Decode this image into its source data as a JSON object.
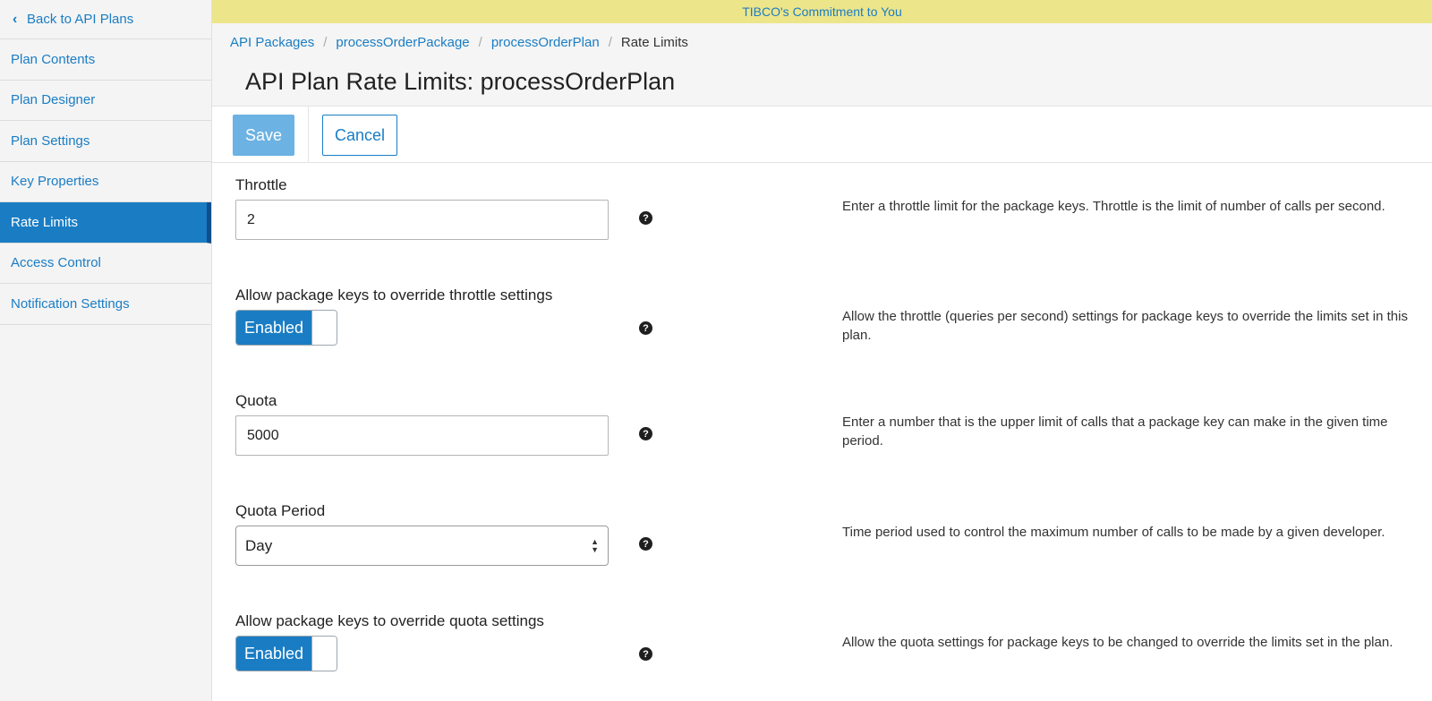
{
  "sidebar": {
    "back_label": "Back to API Plans",
    "items": [
      {
        "label": "Plan Contents"
      },
      {
        "label": "Plan Designer"
      },
      {
        "label": "Plan Settings"
      },
      {
        "label": "Key Properties"
      },
      {
        "label": "Rate Limits",
        "active": true
      },
      {
        "label": "Access Control"
      },
      {
        "label": "Notification Settings"
      }
    ]
  },
  "banner": {
    "text": "TIBCO's Commitment to You"
  },
  "breadcrumb": {
    "items": [
      "API Packages",
      "processOrderPackage",
      "processOrderPlan"
    ],
    "current": "Rate Limits",
    "separator": "/"
  },
  "page": {
    "title": "API Plan Rate Limits: processOrderPlan"
  },
  "toolbar": {
    "save_label": "Save",
    "cancel_label": "Cancel"
  },
  "form": {
    "throttle": {
      "label": "Throttle",
      "value": "2",
      "help": "Enter a throttle limit for the package keys. Throttle is the limit of number of calls per second."
    },
    "override_throttle": {
      "label": "Allow package keys to override throttle settings",
      "toggle_label": "Enabled",
      "help": "Allow the throttle (queries per second) settings for package keys to override the limits set in this plan."
    },
    "quota": {
      "label": "Quota",
      "value": "5000",
      "help": "Enter a number that is the upper limit of calls that a package key can make in the given time period."
    },
    "quota_period": {
      "label": "Quota Period",
      "selected": "Day",
      "help": "Time period used to control the maximum number of calls to be made by a given developer."
    },
    "override_quota": {
      "label": "Allow package keys to override quota settings",
      "toggle_label": "Enabled",
      "help": "Allow the quota settings for package keys to be changed to override the limits set in the plan."
    },
    "help_glyph": "?"
  },
  "colors": {
    "accent": "#1a7dc4",
    "banner_bg": "#ede58a",
    "save_disabled": "#6cb2e2"
  },
  "icons": {
    "back": "chevron-left-icon",
    "help": "question-circle-icon",
    "select": "up-down-arrows-icon"
  }
}
